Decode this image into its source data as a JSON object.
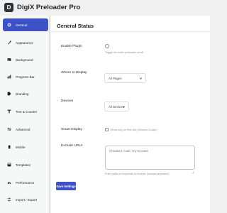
{
  "app": {
    "title": "DigiX Preloader Pro",
    "logo_text": "D"
  },
  "sidebar": {
    "items": [
      {
        "label": "General",
        "icon": "gear-icon"
      },
      {
        "label": "Appearance",
        "icon": "brush-icon"
      },
      {
        "label": "Background",
        "icon": "image-icon"
      },
      {
        "label": "Progress Bar",
        "icon": "bar-icon"
      },
      {
        "label": "Branding",
        "icon": "tag-icon"
      },
      {
        "label": "Text & Counter",
        "icon": "text-icon"
      },
      {
        "label": "Advanced",
        "icon": "sliders-icon"
      },
      {
        "label": "Mobile",
        "icon": "mobile-icon"
      },
      {
        "label": "Templates",
        "icon": "template-icon"
      },
      {
        "label": "Performance",
        "icon": "speed-icon"
      },
      {
        "label": "Import / Export",
        "icon": "transfer-icon"
      }
    ],
    "active_index": 0,
    "accent": "#3f51c7"
  },
  "main": {
    "title": "General Status",
    "enable": {
      "label": "Enable Plugin",
      "helper": "Toggle the entire preloader on/off"
    },
    "where": {
      "label": "Where to Display",
      "value": "All Pages"
    },
    "devices": {
      "label": "Devices",
      "value": "All Devices"
    },
    "smart": {
      "label": "Smart Display",
      "helper": "Show only on first visit (Session Cookie)"
    },
    "exclude": {
      "label": "Exclude URLs",
      "placeholder": "/checkout, /cart/, /my-account",
      "helper": "Enter paths or keywords to exclude (comma separated)"
    },
    "save_label": "Save Settings"
  }
}
